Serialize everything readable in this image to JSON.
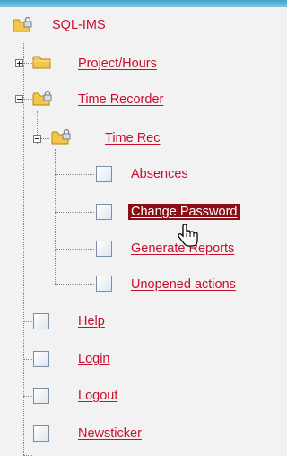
{
  "tree": {
    "root": {
      "label": "SQL-IMS",
      "icon": "folder-lock-icon"
    },
    "items": [
      {
        "label": "Project/Hours",
        "icon": "folder-icon",
        "state": "collapsed"
      },
      {
        "label": "Time Recorder",
        "icon": "folder-lock-icon",
        "state": "expanded"
      },
      {
        "label": "Time Rec",
        "icon": "folder-lock-icon",
        "state": "expanded"
      },
      {
        "label": "Absences",
        "icon": "page-icon"
      },
      {
        "label": "Change Password",
        "icon": "page-icon",
        "selected": true
      },
      {
        "label": "Generate Reports",
        "icon": "page-icon"
      },
      {
        "label": "Unopened actions",
        "icon": "page-icon"
      },
      {
        "label": "Help",
        "icon": "page-icon"
      },
      {
        "label": "Login",
        "icon": "page-icon"
      },
      {
        "label": "Logout",
        "icon": "page-icon"
      },
      {
        "label": "Newsticker",
        "icon": "page-icon"
      }
    ]
  },
  "colors": {
    "link": "#c8102e",
    "selected_background": "#8b0d13",
    "selected_text": "#ffffff",
    "folder": "#f3c64b",
    "page_background": "#f2f2f2"
  },
  "cursor": {
    "icon": "hand-pointer-icon"
  }
}
